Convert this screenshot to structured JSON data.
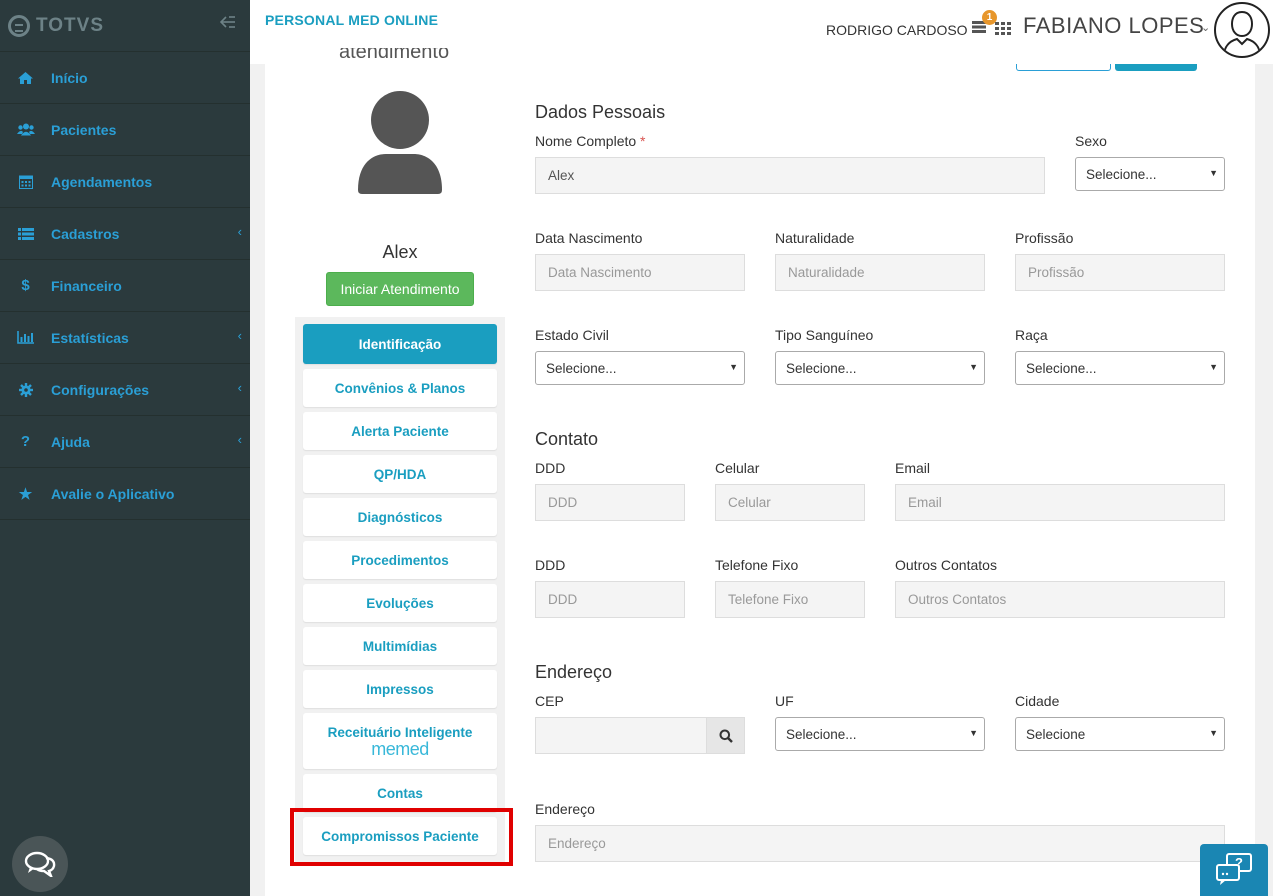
{
  "sidebar": {
    "brand": "TOTVS",
    "items": [
      {
        "label": "Início",
        "icon": "home-icon"
      },
      {
        "label": "Pacientes",
        "icon": "users-icon"
      },
      {
        "label": "Agendamentos",
        "icon": "calendar-icon"
      },
      {
        "label": "Cadastros",
        "icon": "list-icon"
      },
      {
        "label": "Financeiro",
        "icon": "dollar-icon"
      },
      {
        "label": "Estatísticas",
        "icon": "bar-chart-icon"
      },
      {
        "label": "Configurações",
        "icon": "gear-icon"
      },
      {
        "label": "Ajuda",
        "icon": "question-icon"
      },
      {
        "label": "Avalie o Aplicativo",
        "icon": "star-icon"
      }
    ]
  },
  "header": {
    "app_title": "PERSONAL MED ONLINE",
    "secondary_user": "RODRIGO CARDOSO",
    "notification_count": "1",
    "current_user": "FABIANO LOPES"
  },
  "patient": {
    "partial_title": "atendimento",
    "name": "Alex",
    "start_button": "Iniciar Atendimento"
  },
  "patient_menu": [
    {
      "label": "Identificação",
      "active": true
    },
    {
      "label": "Convênios & Planos"
    },
    {
      "label": "Alerta Paciente"
    },
    {
      "label": "QP/HDA"
    },
    {
      "label": "Diagnósticos"
    },
    {
      "label": "Procedimentos"
    },
    {
      "label": "Evoluções"
    },
    {
      "label": "Multimídias"
    },
    {
      "label": "Impressos"
    },
    {
      "label": "Receituário Inteligente",
      "sub": "memed"
    },
    {
      "label": "Contas"
    },
    {
      "label": "Compromissos Paciente"
    }
  ],
  "form": {
    "personal": {
      "title": "Dados Pessoais",
      "full_name_label": "Nome Completo",
      "required_mark": "*",
      "full_name_value": "Alex",
      "sex_label": "Sexo",
      "sex_value": "Selecione...",
      "birth_label": "Data Nascimento",
      "birth_placeholder": "Data Nascimento",
      "nat_label": "Naturalidade",
      "nat_placeholder": "Naturalidade",
      "prof_label": "Profissão",
      "prof_placeholder": "Profissão",
      "civil_label": "Estado Civil",
      "civil_value": "Selecione...",
      "blood_label": "Tipo Sanguíneo",
      "blood_value": "Selecione...",
      "race_label": "Raça",
      "race_value": "Selecione..."
    },
    "contact": {
      "title": "Contato",
      "ddd_label": "DDD",
      "ddd_placeholder": "DDD",
      "cell_label": "Celular",
      "cell_placeholder": "Celular",
      "email_label": "Email",
      "email_placeholder": "Email",
      "ddd2_label": "DDD",
      "ddd2_placeholder": "DDD",
      "phone_label": "Telefone Fixo",
      "phone_placeholder": "Telefone Fixo",
      "other_label": "Outros Contatos",
      "other_placeholder": "Outros Contatos"
    },
    "address": {
      "title": "Endereço",
      "cep_label": "CEP",
      "uf_label": "UF",
      "uf_value": "Selecione...",
      "city_label": "Cidade",
      "city_value": "Selecione",
      "address_label": "Endereço",
      "address_placeholder": "Endereço"
    }
  },
  "colors": {
    "sidebar_bg": "#2b3a3d",
    "accent": "#1a9ec0",
    "success": "#5cb85c",
    "highlight": "#e00000"
  }
}
